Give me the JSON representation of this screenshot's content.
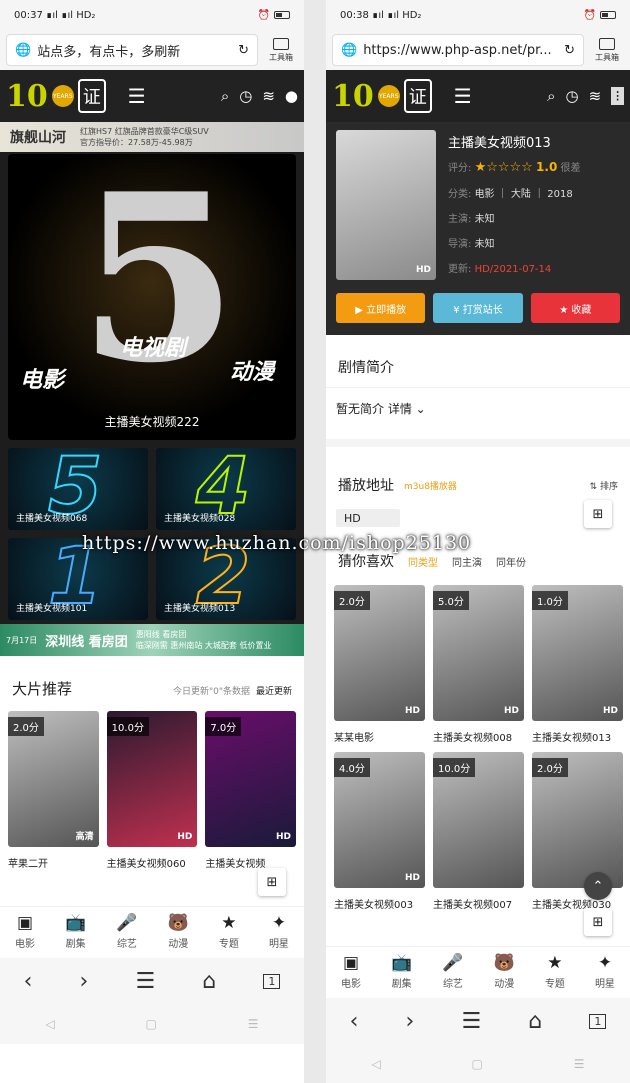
{
  "left": {
    "status": {
      "time": "00:37",
      "signal": "∎ıl ∎ıl HD₂"
    },
    "address": {
      "text": "站点多，有点卡，多刷新",
      "toolbox": "工具箱"
    },
    "header": {
      "logo_ten": "10",
      "logo_years": "YEARS",
      "logo_char": "证"
    },
    "top_ad": {
      "brand": "旗舰山河",
      "line": "红旗HS7 红旗品牌首款豪华C级SUV",
      "price": "官方指导价：27.58万-45.98万"
    },
    "hero": {
      "number": "5",
      "w1": "电影",
      "w2": "电视剧",
      "w3": "动漫",
      "caption": "主播美女视频222"
    },
    "tiles": [
      {
        "num": "5",
        "label": "主播美女视频068"
      },
      {
        "num": "4",
        "label": "主播美女视频028"
      },
      {
        "num": "1",
        "label": "主播美女视频101"
      },
      {
        "num": "2",
        "label": "主播美女视频013"
      }
    ],
    "banner2": {
      "date": "7月17日",
      "title": "深圳线 看房团",
      "sub": "惠阳线 看房团",
      "detail": "临深刚需 惠州南站 大城配套 低价置业"
    },
    "section": {
      "title": "大片推荐",
      "update": "今日更新\"0\"条数据",
      "latest": "最近更新"
    },
    "cards": [
      {
        "score": "2.0分",
        "tag": "高清",
        "title": "苹果二开"
      },
      {
        "score": "10.0分",
        "tag": "HD",
        "title": "主播美女视频060"
      },
      {
        "score": "7.0分",
        "tag": "HD",
        "title": "主播美女视频"
      }
    ],
    "bnav": [
      {
        "icon": "▣",
        "label": "电影"
      },
      {
        "icon": "📺",
        "label": "剧集"
      },
      {
        "icon": "🎤",
        "label": "综艺"
      },
      {
        "icon": "🐻",
        "label": "动漫"
      },
      {
        "icon": "★",
        "label": "专题"
      },
      {
        "icon": "✦",
        "label": "明星"
      }
    ],
    "chrome": {
      "back": "‹",
      "fwd": "›",
      "menu": "☰",
      "home": "⌂",
      "tabs": "1"
    },
    "sys": {
      "back": "◁",
      "home": "▢",
      "menu": "☰"
    }
  },
  "right": {
    "status": {
      "time": "00:38",
      "signal": "∎ıl ∎ıl HD₂"
    },
    "address": {
      "text": "https://www.php-asp.net/pr...",
      "toolbox": "工具箱"
    },
    "detail": {
      "title": "主播美女视频013",
      "rate_label": "评分:",
      "stars": "★☆☆☆☆",
      "score": "1.0",
      "score_word": "很差",
      "cat_label": "分类:",
      "category": "电影 ｜ 大陆 ｜ 2018",
      "actor_label": "主演:",
      "actor": "未知",
      "director_label": "导演:",
      "director": "未知",
      "updated_label": "更新:",
      "updated": "HD/2021-07-14",
      "tag": "HD",
      "btn_play": "▶ 立即播放",
      "btn_tip": "¥ 打赏站长",
      "btn_fav": "★ 收藏"
    },
    "synopsis": {
      "title": "剧情简介",
      "text": "暂无简介 详情 ⌄"
    },
    "play": {
      "title": "播放地址",
      "source": "m3u8播放器",
      "sort": "⇅ 排序",
      "hd": "HD"
    },
    "like": {
      "title": "猜你喜欢",
      "f1": "同类型",
      "f2": "同主演",
      "f3": "同年份"
    },
    "cards": [
      {
        "score": "2.0分",
        "tag": "HD",
        "title": "某某电影"
      },
      {
        "score": "5.0分",
        "tag": "HD",
        "title": "主播美女视频008"
      },
      {
        "score": "1.0分",
        "tag": "HD",
        "title": "主播美女视频013"
      },
      {
        "score": "4.0分",
        "tag": "HD",
        "title": "主播美女视频003"
      },
      {
        "score": "10.0分",
        "tag": "",
        "title": "主播美女视频007"
      },
      {
        "score": "2.0分",
        "tag": "",
        "title": "主播美女视频030"
      }
    ],
    "bnav": [
      {
        "icon": "▣",
        "label": "电影"
      },
      {
        "icon": "📺",
        "label": "剧集"
      },
      {
        "icon": "🎤",
        "label": "综艺"
      },
      {
        "icon": "🐻",
        "label": "动漫"
      },
      {
        "icon": "★",
        "label": "专题"
      },
      {
        "icon": "✦",
        "label": "明星"
      }
    ],
    "chrome": {
      "back": "‹",
      "fwd": "›",
      "menu": "☰",
      "home": "⌂",
      "tabs": "1"
    },
    "sys": {
      "back": "◁",
      "home": "▢",
      "menu": "☰"
    }
  },
  "watermark": "https://www.huzhan.com/ishop25130"
}
